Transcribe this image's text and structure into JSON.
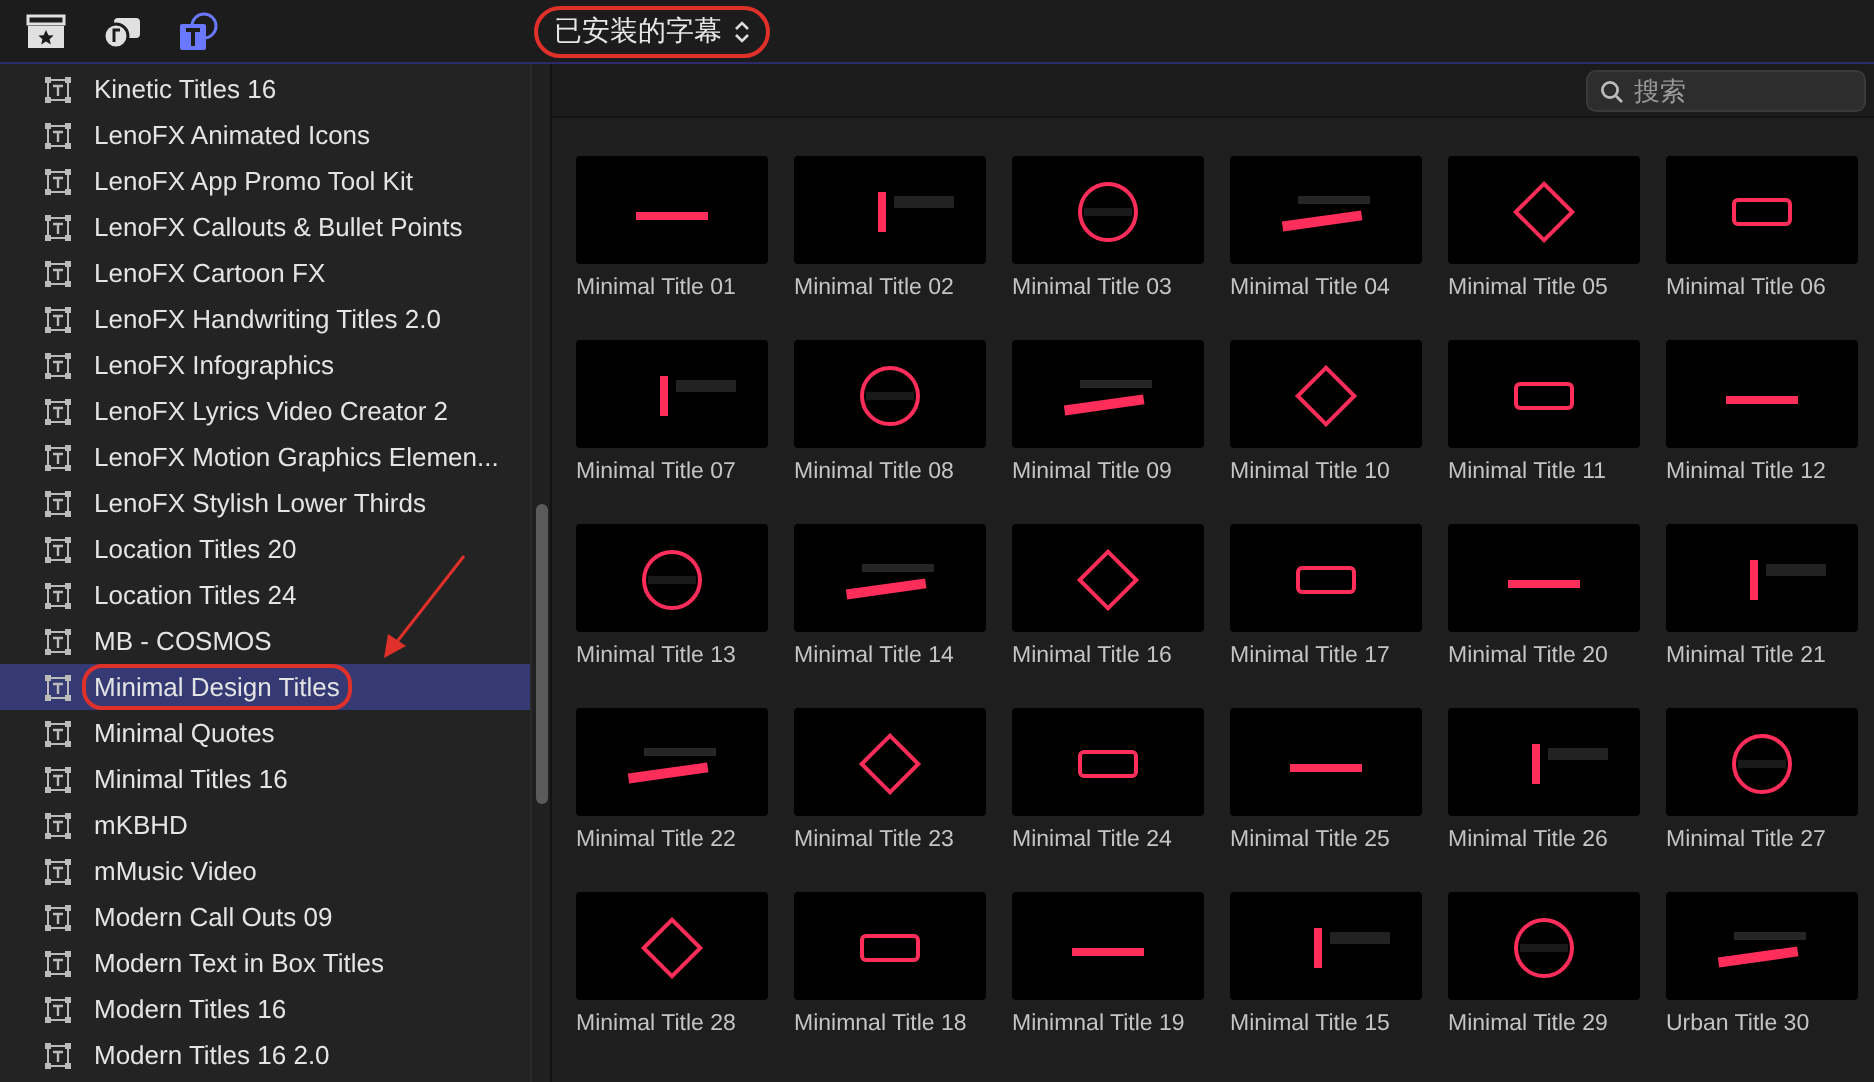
{
  "toolbar": {
    "tabs": [
      {
        "kind": "movie",
        "selected": false
      },
      {
        "kind": "music",
        "selected": false
      },
      {
        "kind": "titles",
        "selected": true
      }
    ],
    "selector": {
      "label": "已安装的字幕",
      "highlighted": true
    }
  },
  "sidebar": {
    "items": [
      {
        "label": "Kinetic Titles 16",
        "selected": false,
        "highlighted": false
      },
      {
        "label": "LenoFX Animated Icons",
        "selected": false,
        "highlighted": false
      },
      {
        "label": "LenoFX App Promo Tool Kit",
        "selected": false,
        "highlighted": false
      },
      {
        "label": "LenoFX Callouts & Bullet Points",
        "selected": false,
        "highlighted": false
      },
      {
        "label": "LenoFX Cartoon FX",
        "selected": false,
        "highlighted": false
      },
      {
        "label": "LenoFX Handwriting Titles 2.0",
        "selected": false,
        "highlighted": false
      },
      {
        "label": "LenoFX Infographics",
        "selected": false,
        "highlighted": false
      },
      {
        "label": "LenoFX Lyrics Video Creator 2",
        "selected": false,
        "highlighted": false
      },
      {
        "label": "LenoFX Motion Graphics Elemen...",
        "selected": false,
        "highlighted": false
      },
      {
        "label": "LenoFX Stylish Lower Thirds",
        "selected": false,
        "highlighted": false
      },
      {
        "label": "Location Titles 20",
        "selected": false,
        "highlighted": false
      },
      {
        "label": "Location Titles 24",
        "selected": false,
        "highlighted": false
      },
      {
        "label": "MB - COSMOS",
        "selected": false,
        "highlighted": false
      },
      {
        "label": "Minimal Design Titles",
        "selected": true,
        "highlighted": true
      },
      {
        "label": "Minimal Quotes",
        "selected": false,
        "highlighted": false
      },
      {
        "label": "Minimal Titles 16",
        "selected": false,
        "highlighted": false
      },
      {
        "label": "mKBHD",
        "selected": false,
        "highlighted": false
      },
      {
        "label": "mMusic Video",
        "selected": false,
        "highlighted": false
      },
      {
        "label": "Modern Call Outs 09",
        "selected": false,
        "highlighted": false
      },
      {
        "label": "Modern Text in Box Titles",
        "selected": false,
        "highlighted": false
      },
      {
        "label": "Modern Titles 16",
        "selected": false,
        "highlighted": false
      },
      {
        "label": "Modern Titles 16 2.0",
        "selected": false,
        "highlighted": false
      }
    ]
  },
  "search": {
    "placeholder": "搜索"
  },
  "grid": {
    "items": [
      {
        "label": "Minimal Title 01"
      },
      {
        "label": "Minimal Title 02"
      },
      {
        "label": "Minimal Title 03"
      },
      {
        "label": "Minimal Title 04"
      },
      {
        "label": "Minimal Title 05"
      },
      {
        "label": "Minimal Title 06"
      },
      {
        "label": "Minimal Title 07"
      },
      {
        "label": "Minimal Title 08"
      },
      {
        "label": "Minimal Title 09"
      },
      {
        "label": "Minimal Title 10"
      },
      {
        "label": "Minimal Title 11"
      },
      {
        "label": "Minimal Title 12"
      },
      {
        "label": "Minimal Title 13"
      },
      {
        "label": "Minimal Title 14"
      },
      {
        "label": "Minimal Title 16"
      },
      {
        "label": "Minimal Title 17"
      },
      {
        "label": "Minimal Title 20"
      },
      {
        "label": "Minimal Title 21"
      },
      {
        "label": "Minimal Title 22"
      },
      {
        "label": "Minimal Title 23"
      },
      {
        "label": "Minimal Title 24"
      },
      {
        "label": "Minimal Title 25"
      },
      {
        "label": "Minimal Title 26"
      },
      {
        "label": "Minimal Title 27"
      },
      {
        "label": "Minimal Title 28"
      },
      {
        "label": "Minimnal Title 18"
      },
      {
        "label": "Minimnal Title 19"
      },
      {
        "label": "Minimal Title 15"
      },
      {
        "label": "Minimal Title 29"
      },
      {
        "label": "Urban Title 30"
      }
    ]
  }
}
